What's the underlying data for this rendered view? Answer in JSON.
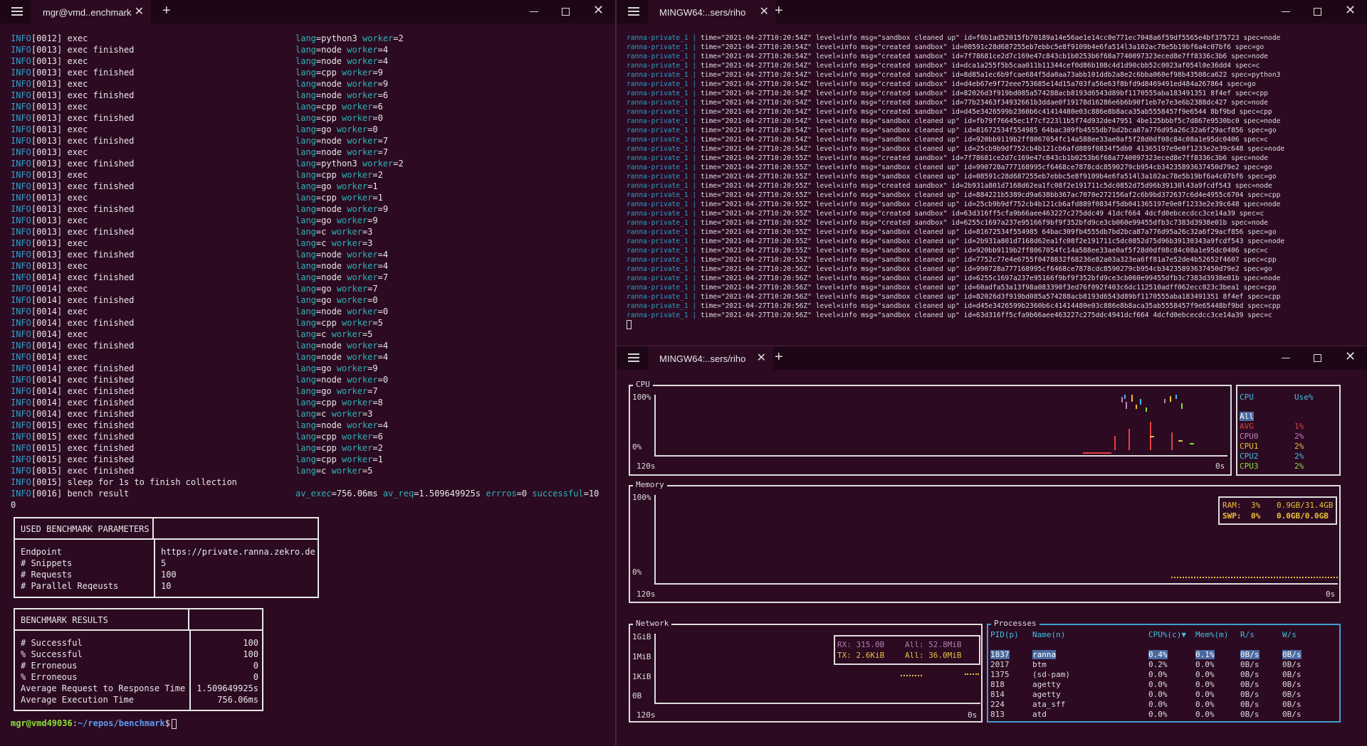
{
  "left": {
    "tab_title": "mgr@vmd..enchmark",
    "log": [
      [
        "INFO[0012] exec",
        "lang",
        "python3",
        "worker",
        "2"
      ],
      [
        "INFO[0013] exec finished",
        "lang",
        "node",
        "worker",
        "4"
      ],
      [
        "INFO[0013] exec",
        "lang",
        "node",
        "worker",
        "4"
      ],
      [
        "INFO[0013] exec finished",
        "lang",
        "cpp",
        "worker",
        "9"
      ],
      [
        "INFO[0013] exec",
        "lang",
        "node",
        "worker",
        "9"
      ],
      [
        "INFO[0013] exec finished",
        "lang",
        "node",
        "worker",
        "6"
      ],
      [
        "INFO[0013] exec",
        "lang",
        "cpp",
        "worker",
        "6"
      ],
      [
        "INFO[0013] exec finished",
        "lang",
        "cpp",
        "worker",
        "0"
      ],
      [
        "INFO[0013] exec",
        "lang",
        "go",
        "worker",
        "0"
      ],
      [
        "INFO[0013] exec finished",
        "lang",
        "node",
        "worker",
        "7"
      ],
      [
        "INFO[0013] exec",
        "lang",
        "node",
        "worker",
        "7"
      ],
      [
        "INFO[0013] exec finished",
        "lang",
        "python3",
        "worker",
        "2"
      ],
      [
        "INFO[0013] exec",
        "lang",
        "cpp",
        "worker",
        "2"
      ],
      [
        "INFO[0013] exec finished",
        "lang",
        "go",
        "worker",
        "1"
      ],
      [
        "INFO[0013] exec",
        "lang",
        "cpp",
        "worker",
        "1"
      ],
      [
        "INFO[0013] exec finished",
        "lang",
        "node",
        "worker",
        "9"
      ],
      [
        "INFO[0013] exec",
        "lang",
        "go",
        "worker",
        "9"
      ],
      [
        "INFO[0013] exec finished",
        "lang",
        "c",
        "worker",
        "3"
      ],
      [
        "INFO[0013] exec",
        "lang",
        "c",
        "worker",
        "3"
      ],
      [
        "INFO[0013] exec finished",
        "lang",
        "node",
        "worker",
        "4"
      ],
      [
        "INFO[0013] exec",
        "lang",
        "node",
        "worker",
        "4"
      ],
      [
        "INFO[0014] exec finished",
        "lang",
        "node",
        "worker",
        "7"
      ],
      [
        "INFO[0014] exec",
        "lang",
        "go",
        "worker",
        "7"
      ],
      [
        "INFO[0014] exec finished",
        "lang",
        "go",
        "worker",
        "0"
      ],
      [
        "INFO[0014] exec",
        "lang",
        "node",
        "worker",
        "0"
      ],
      [
        "INFO[0014] exec finished",
        "lang",
        "cpp",
        "worker",
        "5"
      ],
      [
        "INFO[0014] exec",
        "lang",
        "c",
        "worker",
        "5"
      ],
      [
        "INFO[0014] exec finished",
        "lang",
        "node",
        "worker",
        "4"
      ],
      [
        "INFO[0014] exec",
        "lang",
        "node",
        "worker",
        "4"
      ],
      [
        "INFO[0014] exec finished",
        "lang",
        "go",
        "worker",
        "9"
      ],
      [
        "INFO[0014] exec finished",
        "lang",
        "node",
        "worker",
        "0"
      ],
      [
        "INFO[0014] exec finished",
        "lang",
        "go",
        "worker",
        "7"
      ],
      [
        "INFO[0014] exec finished",
        "lang",
        "cpp",
        "worker",
        "8"
      ],
      [
        "INFO[0014] exec finished",
        "lang",
        "c",
        "worker",
        "3"
      ],
      [
        "INFO[0015] exec finished",
        "lang",
        "node",
        "worker",
        "4"
      ],
      [
        "INFO[0015] exec finished",
        "lang",
        "cpp",
        "worker",
        "6"
      ],
      [
        "INFO[0015] exec finished",
        "lang",
        "cpp",
        "worker",
        "2"
      ],
      [
        "INFO[0015] exec finished",
        "lang",
        "cpp",
        "worker",
        "1"
      ],
      [
        "INFO[0015] exec finished",
        "lang",
        "c",
        "worker",
        "5"
      ]
    ],
    "sleep_line": "INFO[0015] sleep for 1s to finish collection",
    "bench_line": "INFO[0016] bench result",
    "bench_stats": "av_exec=756.06ms av_req=1.509649925s errros=0 successful=10",
    "zero_line": "0",
    "params": {
      "title": "USED BENCHMARK PARAMETERS",
      "rows": [
        [
          "Endpoint",
          "https://private.ranna.zekro.de"
        ],
        [
          "# Snippets",
          "5"
        ],
        [
          "# Requests",
          "100"
        ],
        [
          "# Parallel Reqeusts",
          "10"
        ]
      ]
    },
    "results": {
      "title": "BENCHMARK RESULTS",
      "rows": [
        [
          "# Successful",
          "100"
        ],
        [
          "% Successful",
          "100"
        ],
        [
          "# Erroneous",
          "0"
        ],
        [
          "% Erroneous",
          "0"
        ],
        [
          "Average Request to Response Time",
          "1.509649925s"
        ],
        [
          "Average Execution Time",
          "756.06ms"
        ]
      ]
    },
    "prompt_user": "mgr@vmd49036",
    "prompt_path": "~/repos/benchmark",
    "prompt_sym": "$"
  },
  "topright": {
    "tab_title": "MINGW64:..sers/riho",
    "lines": [
      "time=\"2021-04-27T10:20:54Z\" level=info msg=\"sandbox cleaned up\" id=f6b1ad52015fb70189a14e56ae1e14cc0e771ec7048a6f59df5565e4bf375723 spec=node",
      "time=\"2021-04-27T10:20:54Z\" level=info msg=\"created sandbox\" id=08591c28d687255eb7ebbc5e8f9109b4e6fa514l3a102ac78e5b19bf6a4c07bf6 spec=go",
      "time=\"2021-04-27T10:20:54Z\" level=info msg=\"created sandbox\" id=7f78681ce2d7c169e47c843cb1b0253b6f68a7740097323eced8e7ff8336c3b6 spec=node",
      "time=\"2021-04-27T10:20:54Z\" level=info msg=\"created sandbox\" id=dca1a255f5b5caa011b11344cef0d86b108c4d1d90cbb52c0023af054l0e36dd4 spec=c",
      "time=\"2021-04-27T10:20:54Z\" level=info msg=\"created sandbox\" id=8d85a1ec6b9fcae684f5da0aa73abb101ddb2a8e2c6bba060ef98b43508ca622 spec=python3",
      "time=\"2021-04-27T10:20:54Z\" level=info msg=\"created sandbox\" id=d4eb67e9f72eee753685e14d15a703fa56e63f8bfd9d8469491ed484a267864 spec=go",
      "time=\"2021-04-27T10:20:54Z\" level=info msg=\"created sandbox\" id=82026d3f919bd085a574288acb8193d6543d89bf1170555aba183491351 8f4ef spec=cpp",
      "time=\"2021-04-27T10:20:54Z\" level=info msg=\"created sandbox\" id=77b23463f34932661b3ddae0f19178d16286e6b6b90f1eb7e7e3e6b2388dc427 spec=node",
      "time=\"2021-04-27T10:20:54Z\" level=info msg=\"created sandbox\" id=d45e3426599b2360b6c41414480e03c886e8b8aca35ab5558457f9e6544 8bf9bd spec=cpp",
      "time=\"2021-04-27T10:20:54Z\" level=info msg=\"sandbox cleaned up\" id=fb79f76645ec1f7cf223l1b5f74d932de47951 4be125bbbf5c7d867e9530bc0 spec=node",
      "time=\"2021-04-27T10:20:54Z\" level=info msg=\"sandbox cleaned up\" id=81672534f554985 64bac309fb4555db7bd2bca87a776d95a26c32a6f29acf856 spec=go",
      "time=\"2021-04-27T10:20:54Z\" level=info msg=\"sandbox cleaned up\" id=920bb9119b2ff8067054fc14a588ee33ae0af5f28d0df08c84c08a1e95dc0406 spec=c",
      "time=\"2021-04-27T10:20:54Z\" level=info msg=\"sandbox cleaned up\" id=25cb9b9df752cb4b121cb6afd889f0834f5db0 41365197e9e0f1233e2e39c648 spec=node",
      "time=\"2021-04-27T10:20:55Z\" level=info msg=\"created sandbox\" id=7f78681ce2d7c169e47c843cb1b0253b6f68a7740097323eced8e7ff8336c3b6 spec=node",
      "time=\"2021-04-27T10:20:55Z\" level=info msg=\"sandbox cleaned up\" id=990728a777168995cf6468ce7878cdc8590279cb954cb34235893637450d79e2 spec=go",
      "time=\"2021-04-27T10:20:55Z\" level=info msg=\"sandbox cleaned up\" id=08591c28d687255eb7ebbc5e8f9109b4e6fa514l3a102ac78e5b19bf6a4c07bf6 spec=go",
      "time=\"2021-04-27T10:20:55Z\" level=info msg=\"created sandbox\" id=2b931a801d7168d62ea1fc08f2e191711c5dc0852d75d96b39130l43a9fcdf543 spec=node",
      "time=\"2021-04-27T10:20:55Z\" level=info msg=\"sandbox cleaned up\" id=884221b5389cd9a638bb367ac7070e272156af2c6b9bd372637c6d4e4955c6704 spec=cpp",
      "time=\"2021-04-27T10:20:55Z\" level=info msg=\"sandbox cleaned up\" id=25cb9b9df752cb4b121cb6afd889f0834f5db041365197e9e0f1233e2e39c648 spec=node",
      "time=\"2021-04-27T10:20:55Z\" level=info msg=\"created sandbox\" id=63d316ff5cfa9b66aee463227c275ddc49 41dcf664 4dcfd0ebcecdcc3ce14a39 spec=c",
      "time=\"2021-04-27T10:20:55Z\" level=info msg=\"created sandbox\" id=6255c1697a237e95166f9bf9f352bfd9ce3cb060e99455dfb3c7383d3938e01b spec=node",
      "time=\"2021-04-27T10:20:55Z\" level=info msg=\"sandbox cleaned up\" id=81672534f554985 64bac309fb4555db7bd2bca87a776d95a26c32a6f29acf856 spec=go",
      "time=\"2021-04-27T10:20:55Z\" level=info msg=\"sandbox cleaned up\" id=2b931a801d7168d62ea1fc08f2e191711c5dc0852d75d96b39130343a9fcdf543 spec=node",
      "time=\"2021-04-27T10:20:55Z\" level=info msg=\"sandbox cleaned up\" id=920bb9119b2ff8067054fc14a588ee33ae0af5f28d0df08c84c08a1e95dc0406 spec=c",
      "time=\"2021-04-27T10:20:55Z\" level=info msg=\"sandbox cleaned up\" id=7752c77e4e6755f0478832f68236e82a03a323ea6ff81a7e52de4b52652f4607 spec=cpp",
      "time=\"2021-04-27T10:20:56Z\" level=info msg=\"sandbox cleaned up\" id=990728a777168995cf6468ce7878cdc8590279cb954cb34235893637450d79e2 spec=go",
      "time=\"2021-04-27T10:20:56Z\" level=info msg=\"sandbox cleaned up\" id=6255c1697a237e95166f9bf9f352bfd9ce3cb060e99455dfb3c7383d3938e01b spec=node",
      "time=\"2021-04-27T10:20:56Z\" level=info msg=\"sandbox cleaned up\" id=60adfa53a13f98a083390f3ed76f092f403c6dc112510adff062ecc023c3bea1 spec=cpp",
      "time=\"2021-04-27T10:20:56Z\" level=info msg=\"sandbox cleaned up\" id=82026d3f919bd085a574288acb8193d6543d89bf1170555aba183491351 8f4ef spec=cpp",
      "time=\"2021-04-27T10:20:56Z\" level=info msg=\"sandbox cleaned up\" id=d45e3426599b2360b6c41414480e03c886e8b8aca35ab5558457f9e65448bf9bd spec=cpp",
      "time=\"2021-04-27T10:20:56Z\" level=info msg=\"sandbox cleaned up\" id=63d316ff5cfa9b66aee463227c275ddc4941dcf664 4dcfd0ebcecdcc3ce14a39 spec=c"
    ],
    "service": "ranna-private_1",
    "pipe": "|"
  },
  "bottomright": {
    "tab_title": "MINGW64:..sers/riho",
    "cpu": {
      "label": "CPU",
      "y_top": "100%",
      "y_bot": "0%",
      "x_left": "120s",
      "x_right": "0s",
      "table_head": [
        "CPU",
        "Use%"
      ],
      "all": "All",
      "rows": [
        [
          "AVG",
          "1%",
          "#e04040"
        ],
        [
          "CPU0",
          "2%",
          "#c080c0"
        ],
        [
          "CPU1",
          "2%",
          "#e8c23a"
        ],
        [
          "CPU2",
          "2%",
          "#40c0e0"
        ],
        [
          "CPU3",
          "2%",
          "#8ae234"
        ]
      ]
    },
    "memory": {
      "label": "Memory",
      "y_top": "100%",
      "y_bot": "0%",
      "x_left": "120s",
      "x_right": "0s",
      "ram_label": "RAM:",
      "ram_pct": "3%",
      "ram_val": "0.9GB/31.4GB",
      "swp_label": "SWP:",
      "swp_pct": "0%",
      "swp_val": "0.0GB/0.0GB"
    },
    "network": {
      "label": "Network",
      "ticks": [
        "1GiB",
        "1MiB",
        "1KiB",
        "0B"
      ],
      "x_left": "120s",
      "x_right": "0s",
      "rx": "RX: 315.0B",
      "rx_all": "All: 52.8MiB",
      "tx": "TX: 2.6KiB",
      "tx_all": "All: 36.0MiB"
    },
    "processes": {
      "label": "Processes",
      "head": [
        "PID(p)",
        "Name(n)",
        "CPU%(c)▼",
        "Mem%(m)",
        "R/s",
        "W/s"
      ],
      "rows": [
        [
          "1837",
          "ranna",
          "0.4%",
          "0.1%",
          "0B/s",
          "0B/s"
        ],
        [
          "2017",
          "btm",
          "0.2%",
          "0.0%",
          "0B/s",
          "0B/s"
        ],
        [
          "1375",
          "(sd-pam)",
          "0.0%",
          "0.0%",
          "0B/s",
          "0B/s"
        ],
        [
          "818",
          "agetty",
          "0.0%",
          "0.0%",
          "0B/s",
          "0B/s"
        ],
        [
          "814",
          "agetty",
          "0.0%",
          "0.0%",
          "0B/s",
          "0B/s"
        ],
        [
          "224",
          "ata_sff",
          "0.0%",
          "0.0%",
          "0B/s",
          "0B/s"
        ],
        [
          "813",
          "atd",
          "0.0%",
          "0.0%",
          "0B/s",
          "0B/s"
        ]
      ]
    }
  },
  "colors": {
    "bg": "#2c0a22",
    "info": "#2fa0c8",
    "key": "#2ab4b4",
    "prompt_user": "#8ae234",
    "prompt_path": "#5b9cf0",
    "mem_yellow": "#e8c23a"
  }
}
